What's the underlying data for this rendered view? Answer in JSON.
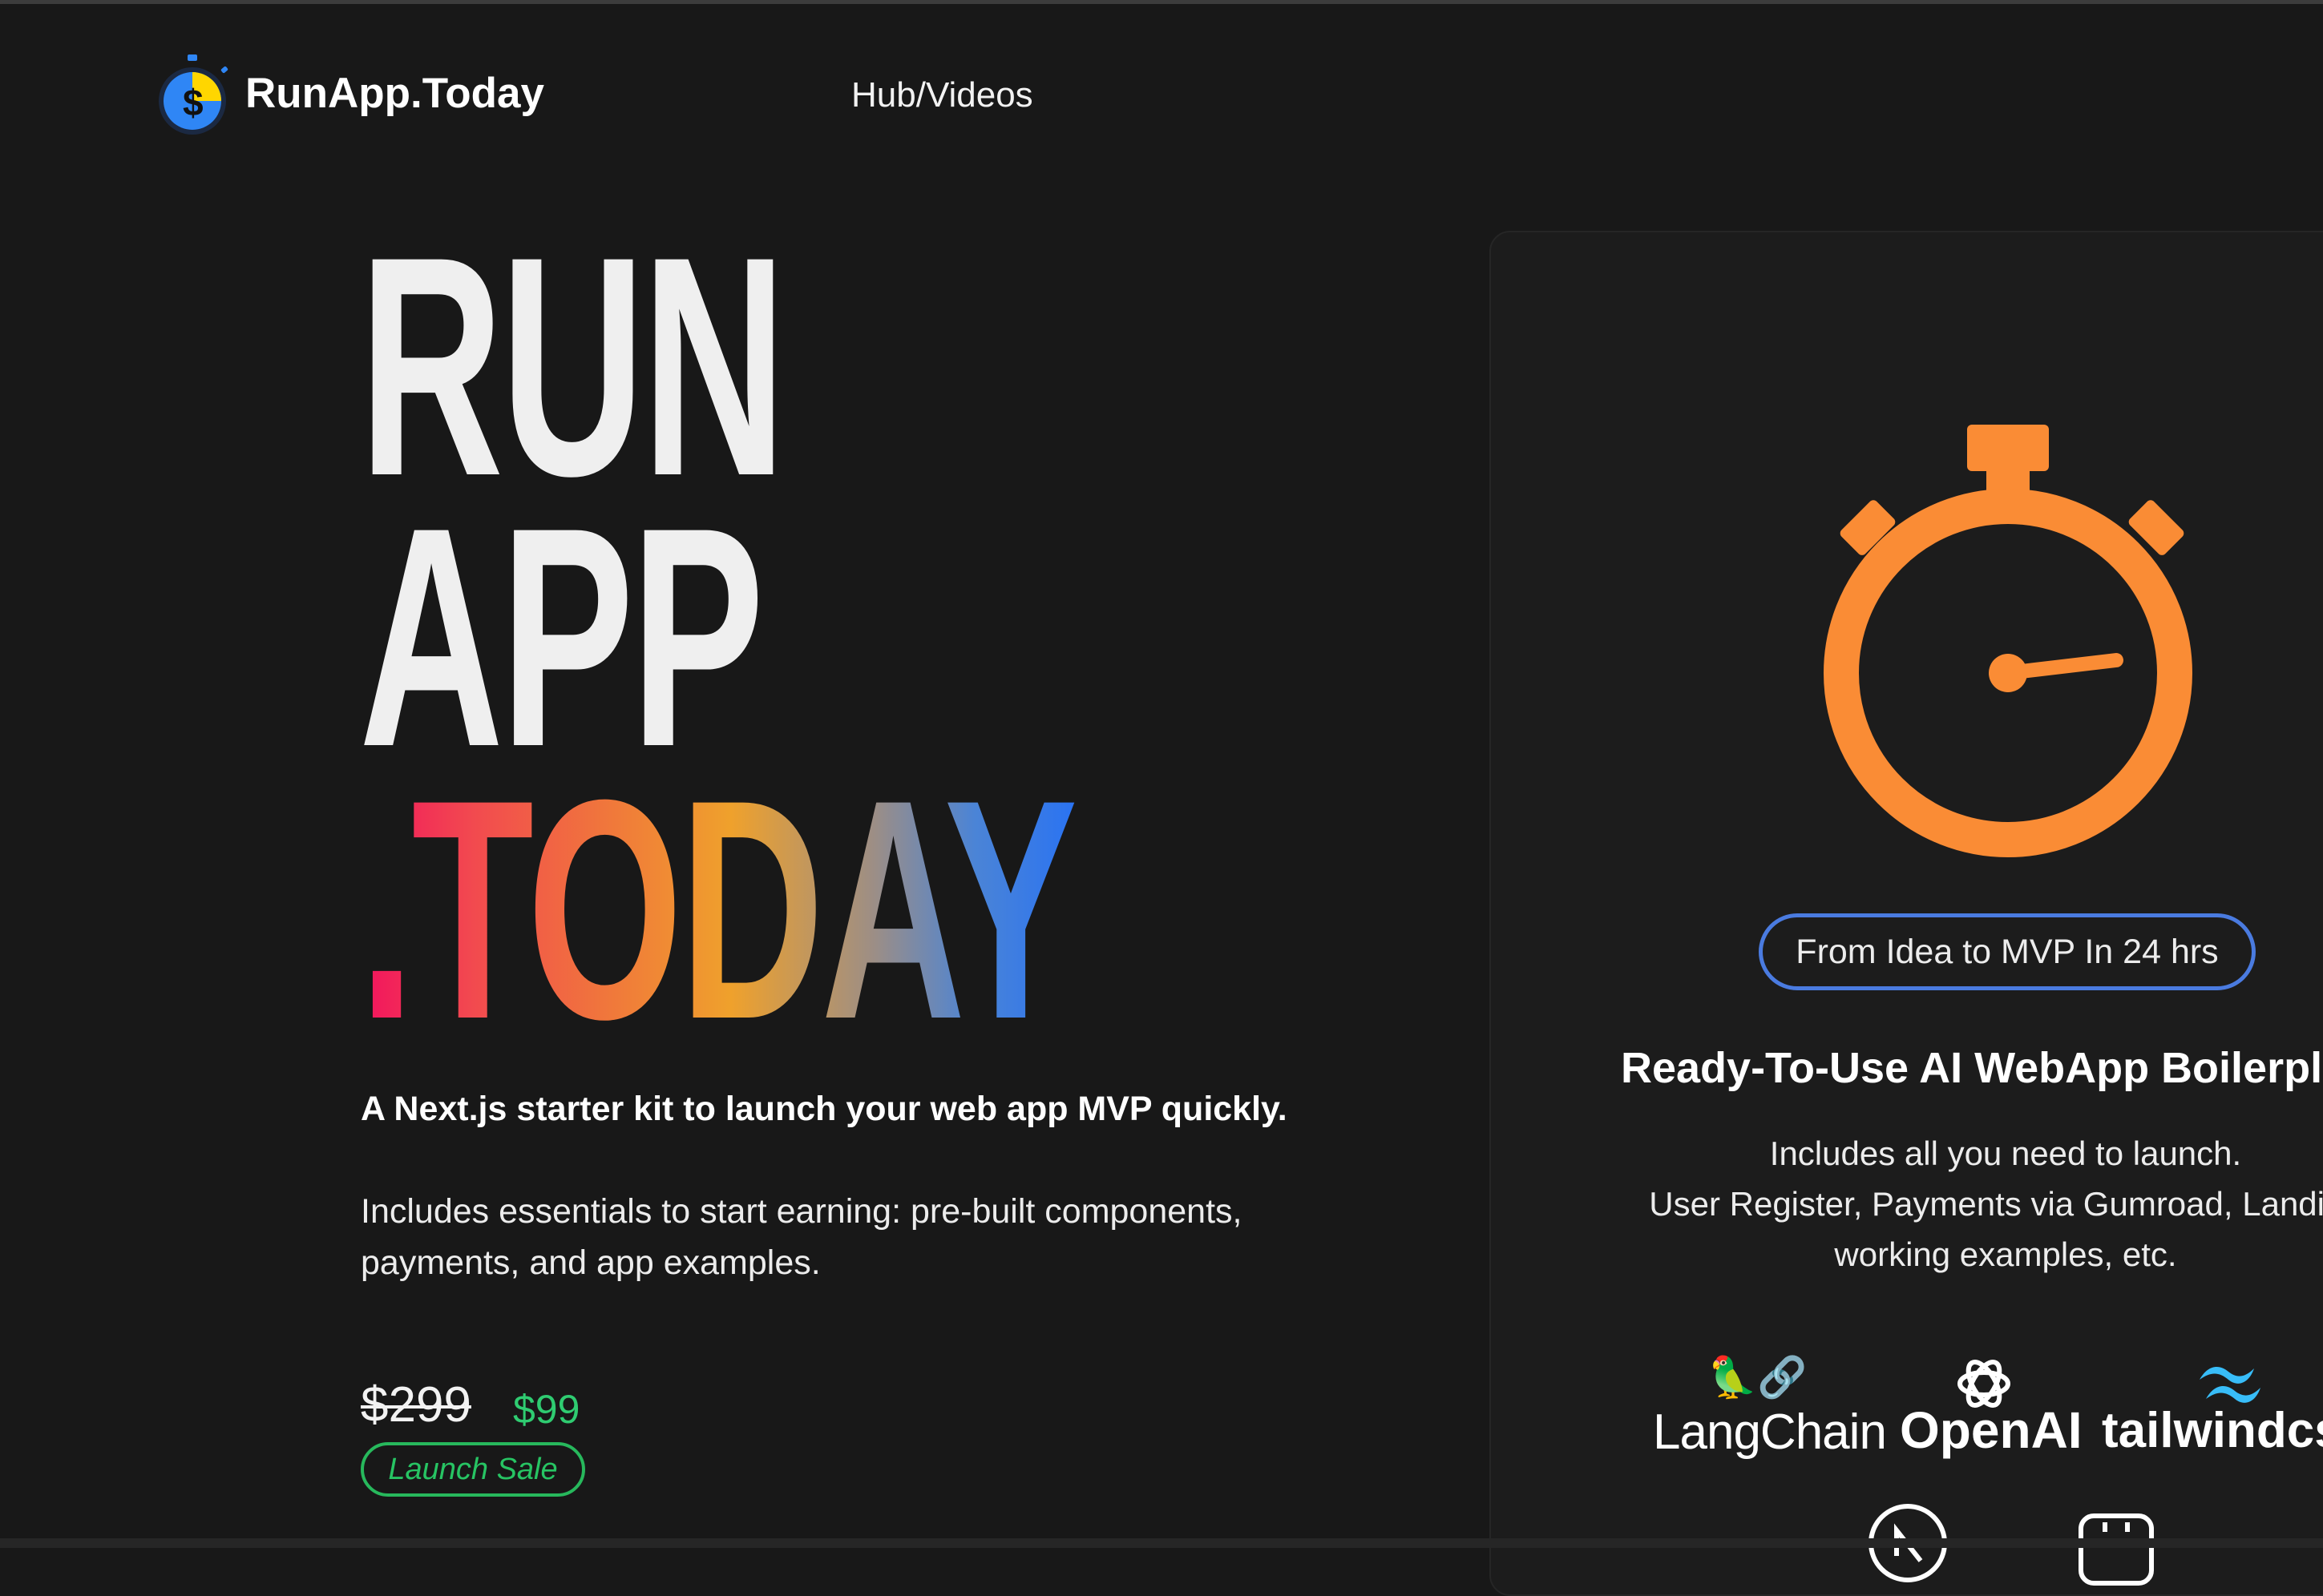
{
  "nav": {
    "logo_icon": "stopwatch-dollar-icon",
    "brand": "RunApp.Today",
    "links": [
      {
        "label": "Hub/Videos"
      }
    ]
  },
  "hero": {
    "line1": "RUN",
    "line2": "APP",
    "line3": ".TODAY",
    "gradient": [
      "#f2135e",
      "#f07a3a",
      "#efa12c",
      "#2a73f2"
    ],
    "tagline": "A Next.js starter kit to launch your web app MVP quickly.",
    "description": "Includes essentials to start earning: pre-built components, payments, and app examples.",
    "price_old": "$299",
    "price_new": "$99",
    "badge": "Launch Sale"
  },
  "card": {
    "icon": "stopwatch-icon",
    "icon_color": "#fa8c35",
    "pill": "From Idea to MVP In 24 hrs",
    "title": "Ready-To-Use AI WebApp Boilerpl",
    "desc_lines": [
      "Includes all you need to launch.",
      "User Register, Payments via Gumroad, Landing",
      "working examples, etc."
    ],
    "tech": {
      "langchain": "LangChain",
      "langchain_icon": "🦜🔗",
      "openai": "OpenAI",
      "tailwind": "tailwindcs"
    }
  },
  "colors": {
    "background": "#181818",
    "accent_green": "#2fcc71",
    "accent_blue": "#4a7be0",
    "accent_orange": "#fa8c35"
  }
}
